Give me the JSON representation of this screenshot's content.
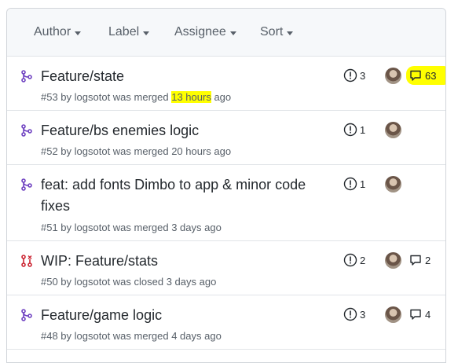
{
  "filters": [
    {
      "label": "Author"
    },
    {
      "label": "Label"
    },
    {
      "label": "Assignee"
    },
    {
      "label": "Sort"
    }
  ],
  "colors": {
    "merged": "#6f42c1",
    "closed": "#cb2431",
    "highlight": "#ffff00"
  },
  "pull_requests": [
    {
      "title": "Feature/state",
      "meta_prefix": "#53 by logsotot was merged",
      "meta_time": "13 hours",
      "meta_suffix": "ago",
      "status": "merged",
      "status_icon": "git-merge-icon",
      "issues": "3",
      "comments": "63"
    },
    {
      "title": "Feature/bs enemies logic",
      "meta": "#52 by logsotot was merged 20 hours ago",
      "status": "merged",
      "status_icon": "git-merge-icon",
      "issues": "1",
      "comments": ""
    },
    {
      "title": "feat: add fonts Dimbo to app & minor code fixes",
      "meta": "#51 by logsotot was merged 3 days ago",
      "status": "merged",
      "status_icon": "git-merge-icon",
      "issues": "1",
      "comments": ""
    },
    {
      "title": "WIP: Feature/stats",
      "meta": "#50 by logsotot was closed 3 days ago",
      "status": "closed",
      "status_icon": "git-pull-request-closed-icon",
      "issues": "2",
      "comments": "2"
    },
    {
      "title": "Feature/game logic",
      "meta": "#48 by logsotot was merged 4 days ago",
      "status": "merged",
      "status_icon": "git-merge-icon",
      "issues": "3",
      "comments": "4"
    }
  ]
}
